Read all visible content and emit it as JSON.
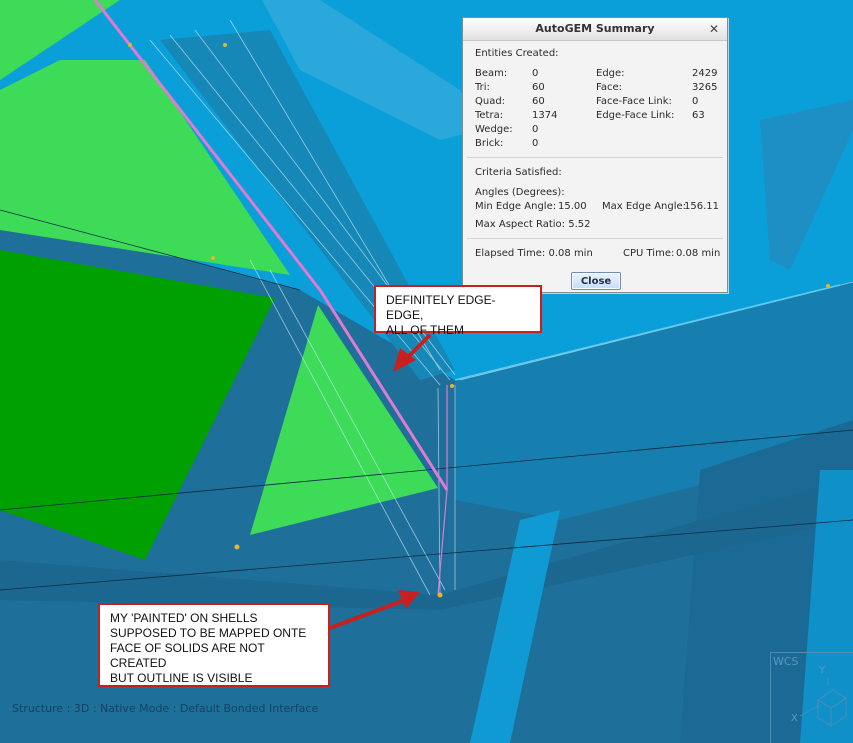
{
  "dialog": {
    "title": "AutoGEM Summary",
    "close_x": "✕",
    "entities_label": "Entities Created:",
    "left": [
      {
        "label": "Beam:",
        "value": "0"
      },
      {
        "label": "Tri:",
        "value": "60"
      },
      {
        "label": "Quad:",
        "value": "60"
      },
      {
        "label": "Tetra:",
        "value": "1374"
      },
      {
        "label": "Wedge:",
        "value": "0"
      },
      {
        "label": "Brick:",
        "value": "0"
      }
    ],
    "right": [
      {
        "label": "Edge:",
        "value": "2429"
      },
      {
        "label": "Face:",
        "value": "3265"
      },
      {
        "label": "Face-Face Link:",
        "value": "0"
      },
      {
        "label": "Edge-Face Link:",
        "value": "63"
      }
    ],
    "criteria_label": "Criteria Satisfied:",
    "angles_label": "Angles (Degrees):",
    "min_edge_label": "Min Edge Angle:",
    "min_edge_value": "15.00",
    "max_edge_label": "Max Edge Angle:",
    "max_edge_value": "156.11",
    "aspect_label": "Max Aspect Ratio:",
    "aspect_value": "5.52",
    "elapsed_label": "Elapsed Time:",
    "elapsed_value": "0.08 min",
    "cpu_label": "CPU Time:",
    "cpu_value": "0.08 min",
    "close_button": "Close"
  },
  "annotations": {
    "callout1_line1": "DEFINITELY EDGE-EDGE,",
    "callout1_line2": "ALL OF THEM",
    "callout2_line1": "MY 'PAINTED' ON SHELLS",
    "callout2_line2": "SUPPOSED TO BE MAPPED ONTE",
    "callout2_line3": "FACE OF SOLIDS ARE NOT CREATED",
    "callout2_line4": "BUT OUTLINE IS VISIBLE"
  },
  "status_text": "Structure : 3D : Native Mode : Default Bonded Interface",
  "wcs": {
    "label": "WCS",
    "x": "X",
    "y": "Y"
  },
  "colors": {
    "surface_light": "#0a9fd8",
    "surface_dark": "#1f6f9b",
    "shell_green": "#3ddb57",
    "shell_dark_green": "#00a000",
    "edge_magenta": "#e07ad2",
    "annotation_red": "#c8201f",
    "dialog_bg": "#f3f3f3"
  }
}
